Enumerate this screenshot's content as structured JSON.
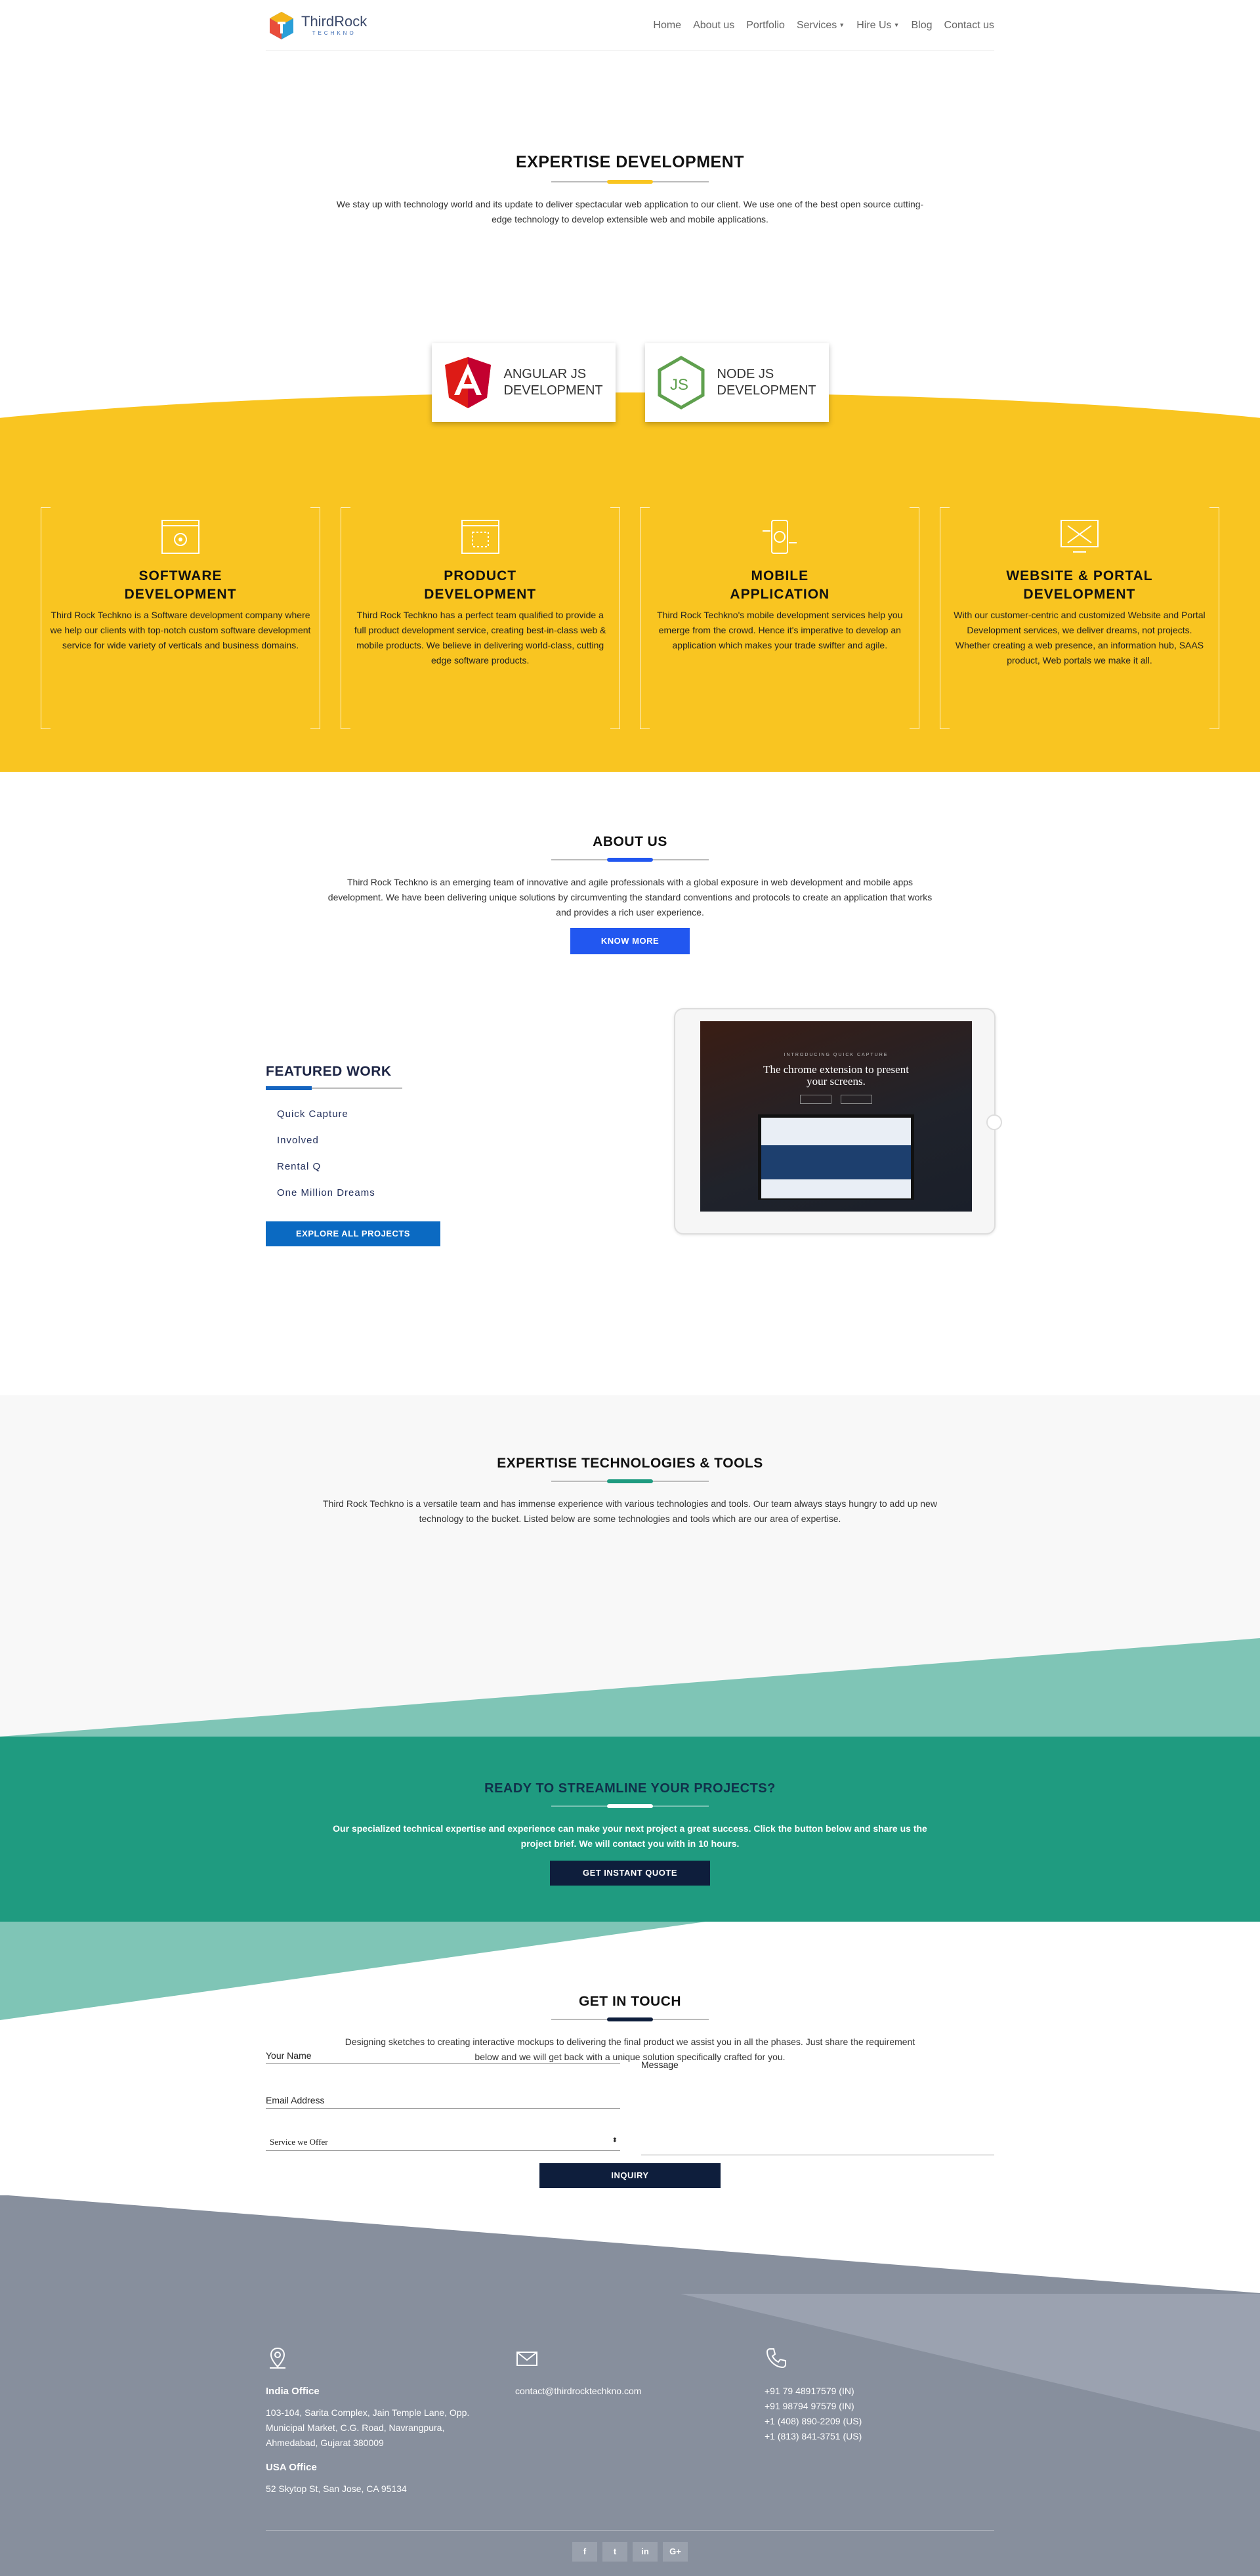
{
  "nav": {
    "brand_main": "ThirdRock",
    "brand_sub": "TECHKNO",
    "items": [
      {
        "label": "Home"
      },
      {
        "label": "About us"
      },
      {
        "label": "Portfolio"
      },
      {
        "label": "Services",
        "dropdown": true
      },
      {
        "label": "Hire Us",
        "dropdown": true
      },
      {
        "label": "Blog"
      },
      {
        "label": "Contact us"
      }
    ]
  },
  "expertise": {
    "title": "EXPERTISE DEVELOPMENT",
    "accent": "#f9c521",
    "text": "We stay up with technology world and its update to deliver spectacular web application to our client. We use one of the best open source cutting-edge technology to develop extensible web and mobile applications.",
    "tech": [
      {
        "icon": "angular-icon",
        "line1": "ANGULAR JS",
        "line2": "DEVELOPMENT"
      },
      {
        "icon": "nodejs-icon",
        "line1": "NODE JS",
        "line2": "DEVELOPMENT"
      }
    ],
    "cards": [
      {
        "icon": "software-icon",
        "title1": "SOFTWARE",
        "title2": "DEVELOPMENT",
        "text": "Third Rock Techkno is a Software development company where we help our clients with top-notch custom software development service for wide variety of verticals and business domains."
      },
      {
        "icon": "product-icon",
        "title1": "PRODUCT",
        "title2": "DEVELOPMENT",
        "text": "Third Rock Techkno has a perfect team qualified to provide a full product development service, creating best-in-class web & mobile products. We believe in delivering world-class, cutting edge software products."
      },
      {
        "icon": "mobile-icon",
        "title1": "MOBILE",
        "title2": "APPLICATION",
        "text": "Third Rock Techkno's mobile development services help you emerge from the crowd. Hence it's imperative to develop an application which makes your trade swifter and agile."
      },
      {
        "icon": "web-portal-icon",
        "title1": "WEBSITE & PORTAL",
        "title2": "DEVELOPMENT",
        "text": "With our customer-centric and customized Website and Portal Development services, we deliver dreams, not projects. Whether creating a web presence, an information hub, SAAS product, Web portals we make it all."
      }
    ]
  },
  "about": {
    "title": "ABOUT US",
    "accent": "#2257f0",
    "text": "Third Rock Techkno is an emerging team of innovative and agile professionals with a global exposure in web development and mobile apps development. We have been delivering unique solutions by circumventing the standard conventions and protocols to create an application that works and provides a rich user experience.",
    "button": "KNOW MORE"
  },
  "featured": {
    "title": "FEATURED WORK",
    "items": [
      "Quick Capture",
      "Involved",
      "Rental Q",
      "One Million Dreams"
    ],
    "button": "EXPLORE ALL PROJECTS",
    "screen_tag": "INTRODUCING QUICK CAPTURE",
    "screen_headline1": "The chrome extension to present",
    "screen_headline2": "your screens."
  },
  "technologies": {
    "title": "EXPERTISE TECHNOLOGIES & TOOLS",
    "accent": "#1f9b80",
    "text": "Third Rock Techkno is a versatile team and has immense experience with various technologies and tools. Our team always stays hungry to add up new technology to the bucket. Listed below are some technologies and tools which are our area of expertise."
  },
  "ready": {
    "title": "READY TO STREAMLINE YOUR PROJECTS?",
    "text": "Our specialized technical expertise and experience can make your next project a great success. Click the button below and share us the project brief. We will contact you with in 10 hours.",
    "button": "GET INSTANT QUOTE"
  },
  "contact": {
    "title": "GET IN TOUCH",
    "accent": "#0e1e3c",
    "text": "Designing sketches to creating interactive mockups to delivering the final product we assist you in all the phases. Just share the requirement below and we will get back with a unique solution specifically crafted for you.",
    "name_label": "Your Name",
    "email_label": "Email Address",
    "service_label": "Service we Offer",
    "message_label": "Message",
    "button": "INQUIRY"
  },
  "footer": {
    "india_title": "India Office",
    "india_address": [
      "103-104, Sarita Complex, Jain Temple Lane, Opp.",
      "Municipal Market, C.G. Road, Navrangpura,",
      "Ahmedabad, Gujarat 380009"
    ],
    "usa_title": "USA Office",
    "usa_address": "52 Skytop St, San Jose, CA 95134",
    "email": "contact@thirdrocktechkno.com",
    "phones": [
      "+91 79 48917579 (IN)",
      "+91 98794 97579 (IN)",
      "+1 (408) 890-2209 (US)",
      "+1 (813) 841-3751 (US)"
    ],
    "social": [
      {
        "icon": "facebook-icon",
        "glyph": "f"
      },
      {
        "icon": "twitter-icon",
        "glyph": "t"
      },
      {
        "icon": "linkedin-icon",
        "glyph": "in"
      },
      {
        "icon": "google-plus-icon",
        "glyph": "G+"
      }
    ]
  }
}
